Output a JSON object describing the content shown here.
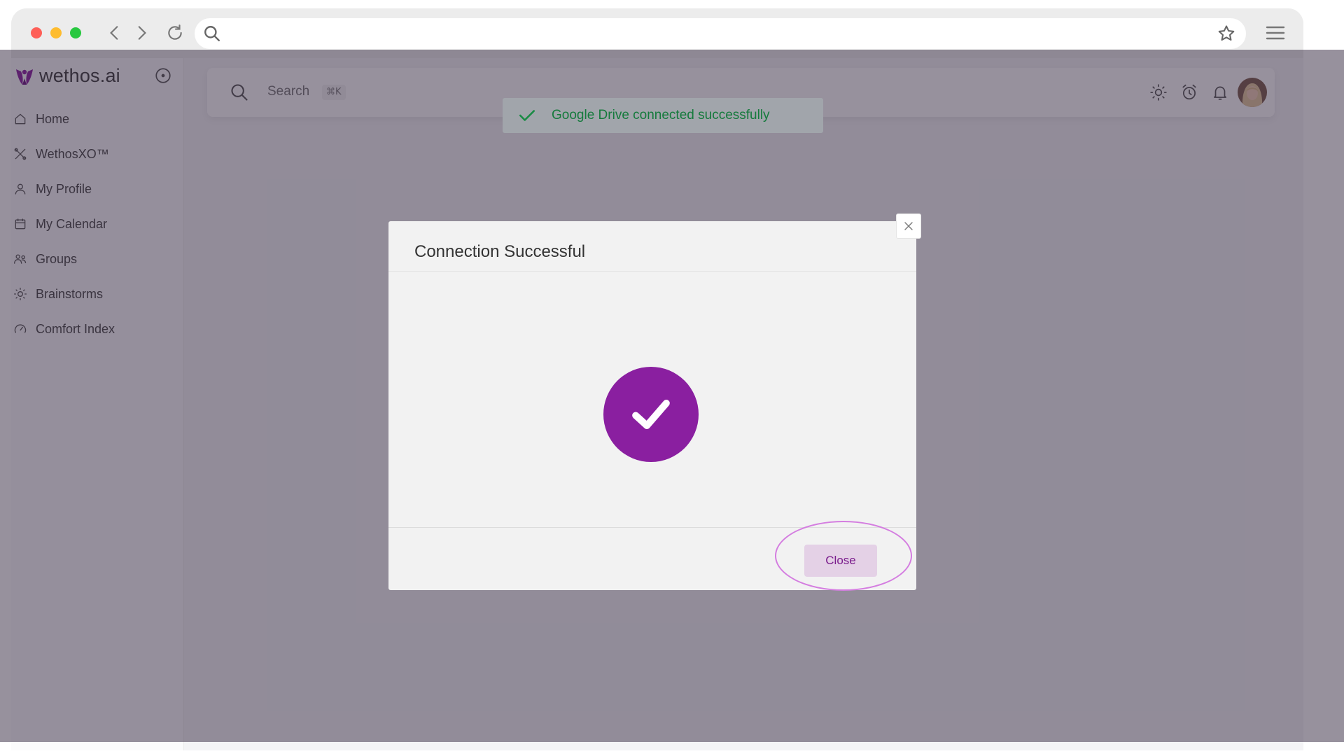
{
  "browser": {
    "url": "",
    "icons": {
      "back": "chevron-left-icon",
      "forward": "chevron-right-icon",
      "reload": "reload-icon",
      "search": "search-icon",
      "bookmark": "star-icon",
      "menu": "hamburger-menu-icon"
    }
  },
  "sidebar": {
    "brand": "wethos.ai",
    "items": [
      {
        "label": "Home",
        "icon": "home-icon"
      },
      {
        "label": "WethosXO™",
        "icon": "xo-icon"
      },
      {
        "label": "My Profile",
        "icon": "user-icon"
      },
      {
        "label": "My Calendar",
        "icon": "calendar-icon"
      },
      {
        "label": "Groups",
        "icon": "groups-icon"
      },
      {
        "label": "Brainstorms",
        "icon": "lightbulb-icon"
      },
      {
        "label": "Comfort Index",
        "icon": "gauge-icon"
      }
    ]
  },
  "topbar": {
    "search_placeholder": "Search",
    "shortcut": "⌘K",
    "icons": [
      "sun-icon",
      "alarm-clock-icon",
      "bell-icon"
    ]
  },
  "toast": {
    "message": "Google Drive connected successfully",
    "color": "#157a3c"
  },
  "modal": {
    "title": "Connection Successful",
    "close_label": "Close",
    "accent": "#8a1fa0"
  }
}
